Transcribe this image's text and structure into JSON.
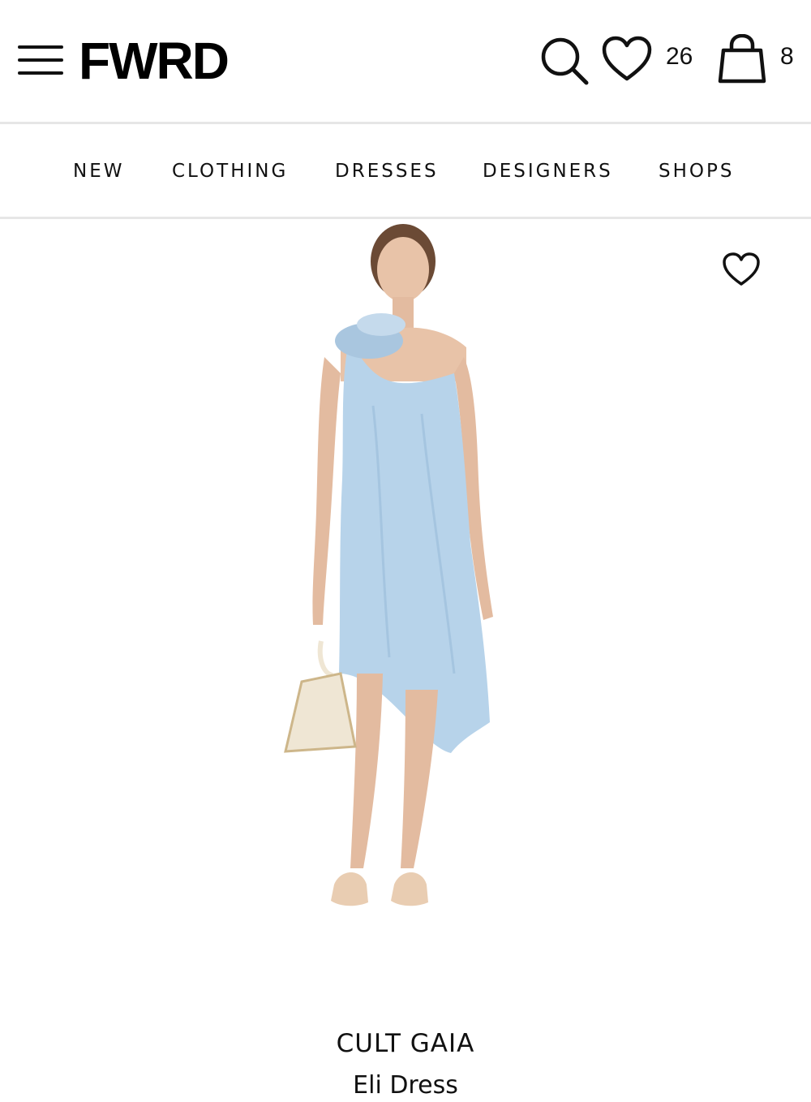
{
  "header": {
    "logo": "FWRD",
    "menu_icon": "hamburger-menu-icon",
    "search_icon": "search-icon",
    "wishlist_icon": "heart-icon",
    "wishlist_count": "26",
    "bag_icon": "shopping-bag-icon",
    "bag_count": "8"
  },
  "nav": {
    "items": [
      "NEW",
      "CLOTHING",
      "DRESSES",
      "DESIGNERS",
      "SHOPS"
    ]
  },
  "product": {
    "favorite_icon": "heart-outline-icon",
    "image_colors": {
      "dress": "#b7d3ea",
      "skin": "#e8c3a8",
      "bag": "#efe6d4"
    },
    "brand": "CULT GAIA",
    "name": "Eli Dress"
  }
}
